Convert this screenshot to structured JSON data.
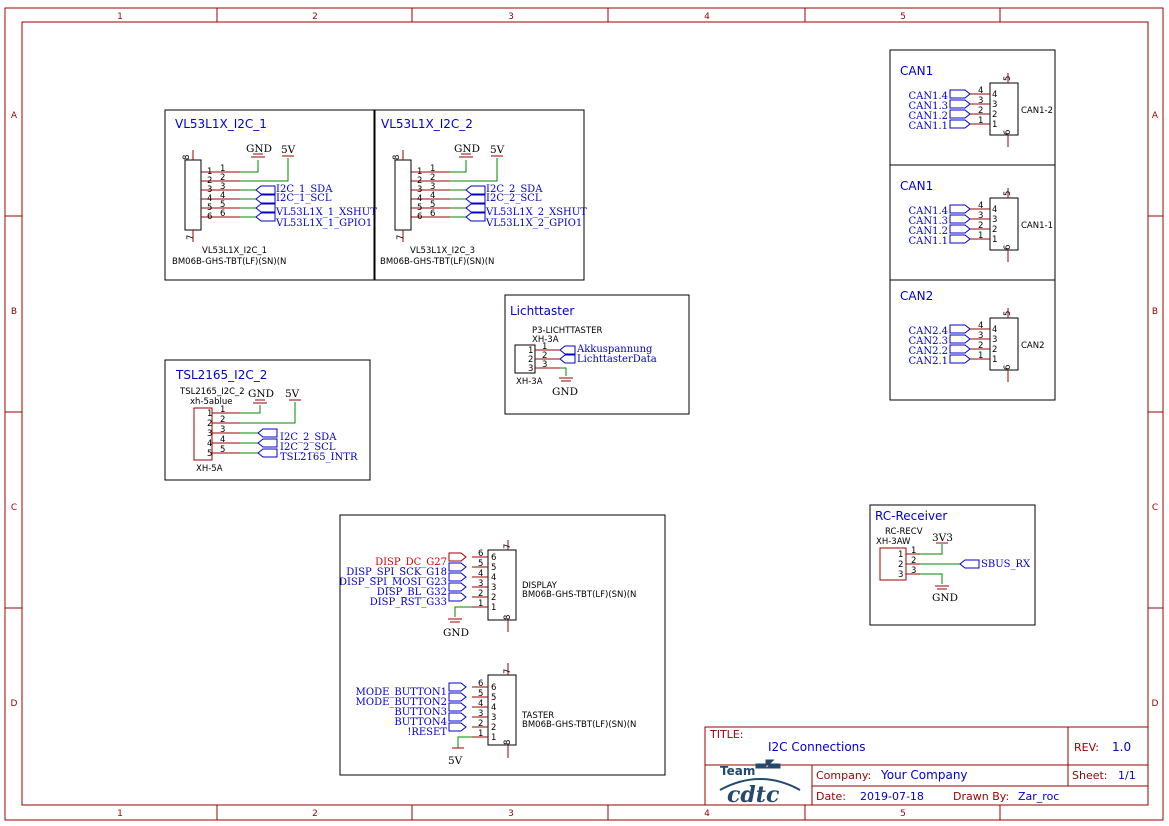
{
  "zones": {
    "columns": [
      "1",
      "2",
      "3",
      "4",
      "5"
    ],
    "rows": [
      "A",
      "B",
      "C",
      "D"
    ]
  },
  "blocks": {
    "vl1": {
      "title": "VL53L1X_I2C_1",
      "part": "VL53L1X_I2C_1",
      "package": "BM06B-GHS-TBT(LF)(SN)(N",
      "nets": [
        "I2C_1_SDA",
        "I2C_1_SCL",
        "VL53L1X_1_XSHUT",
        "VL53L1X_1_GPIO1"
      ]
    },
    "vl2": {
      "title": "VL53L1X_I2C_2",
      "part": "VL53L1X_I2C_3",
      "package": "BM06B-GHS-TBT(LF)(SN)(N",
      "nets": [
        "I2C_2_SDA",
        "I2C_2_SCL",
        "VL53L1X_2_XSHUT",
        "VL53L1X_2_GPIO1"
      ]
    },
    "tsl": {
      "title": "TSL2165_I2C_2",
      "part": "TSL2165_I2C_2",
      "value": "xh-5ablue",
      "package": "XH-5A",
      "nets": [
        "I2C_2_SDA",
        "I2C_2_SCL",
        "TSL2165_INTR"
      ]
    },
    "licht": {
      "title": "Lichttaster",
      "part": "P3-LICHTTASTER",
      "value": "XH-3A",
      "package": "XH-3A",
      "nets": [
        "Akkuspannung",
        "LichttasterData"
      ]
    },
    "can1a": {
      "title": "CAN1",
      "part": "CAN1-2",
      "nets": [
        "CAN1.4",
        "CAN1.3",
        "CAN1.2",
        "CAN1.1"
      ]
    },
    "can1b": {
      "title": "CAN1",
      "part": "CAN1-1",
      "nets": [
        "CAN1.4",
        "CAN1.3",
        "CAN1.2",
        "CAN1.1"
      ]
    },
    "can2": {
      "title": "CAN2",
      "part": "CAN2",
      "nets": [
        "CAN2.4",
        "CAN2.3",
        "CAN2.2",
        "CAN2.1"
      ]
    },
    "rc": {
      "title": "RC-Receiver",
      "part": "RC-RECV",
      "value": "XH-3AW",
      "nets": [
        "SBUS_RX"
      ]
    },
    "display": {
      "part": "DISPLAY",
      "package": "BM06B-GHS-TBT(LF)(SN)(N",
      "nets": [
        "DISP_DC_G27",
        "DISP_SPI_SCK_G18",
        "DISP_SPI_MOSI_G23",
        "DISP_BL_G32",
        "DISP_RST_G33"
      ]
    },
    "taster": {
      "part": "TASTER",
      "package": "BM06B-GHS-TBT(LF)(SN)(N",
      "nets": [
        "MODE_BUTTON1",
        "MODE_BUTTON2",
        "BUTTON3",
        "BUTTON4",
        "!RESET"
      ]
    }
  },
  "power": {
    "gnd": "GND",
    "v5": "5V",
    "v33": "3V3"
  },
  "titleblock": {
    "title_label": "TITLE:",
    "title": "I2C Connections",
    "rev_label": "REV:",
    "rev": "1.0",
    "company_label": "Company:",
    "company": "Your Company",
    "sheet_label": "Sheet:",
    "sheet": "1/1",
    "date_label": "Date:",
    "date": "2019-07-18",
    "drawn_label": "Drawn By:",
    "drawn": "Zar_roc",
    "logo_text": "Team cdtc"
  },
  "colors": {
    "frame": "#990000",
    "wire": "#008800",
    "net": "#0000cc",
    "highlight": "#dd0000"
  }
}
